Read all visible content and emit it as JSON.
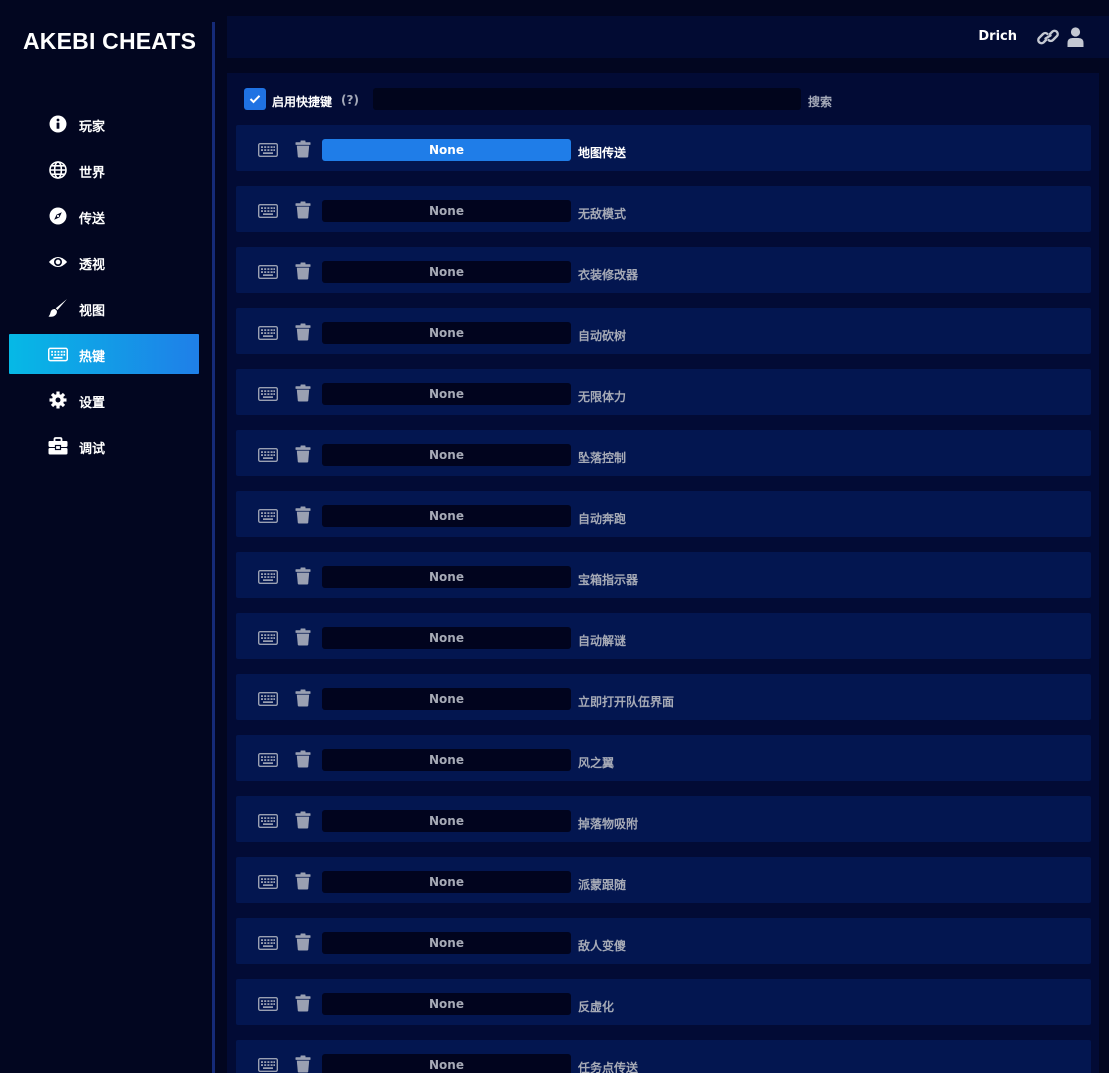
{
  "app": {
    "title": "AKEBI CHEATS"
  },
  "sidebar": {
    "items": [
      {
        "label": "玩家",
        "icon": "info-circle-icon",
        "active": false
      },
      {
        "label": "世界",
        "icon": "globe-icon",
        "active": false
      },
      {
        "label": "传送",
        "icon": "compass-icon",
        "active": false
      },
      {
        "label": "透视",
        "icon": "eye-icon",
        "active": false
      },
      {
        "label": "视图",
        "icon": "paintbrush-icon",
        "active": false
      },
      {
        "label": "热键",
        "icon": "keyboard-icon",
        "active": true
      },
      {
        "label": "设置",
        "icon": "gear-icon",
        "active": false
      },
      {
        "label": "调试",
        "icon": "toolbox-icon",
        "active": false
      }
    ]
  },
  "header": {
    "username": "Drich",
    "icons": [
      "link-icon",
      "user-icon"
    ]
  },
  "toolbar": {
    "enable_label": "启用快捷键",
    "enable_checked": true,
    "help": "(?)",
    "search_value": "",
    "search_label": "搜索"
  },
  "hotkeys": [
    {
      "key": "None",
      "name": "地图传送",
      "active": true
    },
    {
      "key": "None",
      "name": "无敌模式",
      "active": false
    },
    {
      "key": "None",
      "name": "衣装修改器",
      "active": false
    },
    {
      "key": "None",
      "name": "自动砍树",
      "active": false
    },
    {
      "key": "None",
      "name": "无限体力",
      "active": false
    },
    {
      "key": "None",
      "name": "坠落控制",
      "active": false
    },
    {
      "key": "None",
      "name": "自动奔跑",
      "active": false
    },
    {
      "key": "None",
      "name": "宝箱指示器",
      "active": false
    },
    {
      "key": "None",
      "name": "自动解谜",
      "active": false
    },
    {
      "key": "None",
      "name": "立即打开队伍界面",
      "active": false
    },
    {
      "key": "None",
      "name": "风之翼",
      "active": false
    },
    {
      "key": "None",
      "name": "掉落物吸附",
      "active": false
    },
    {
      "key": "None",
      "name": "派蒙跟随",
      "active": false
    },
    {
      "key": "None",
      "name": "敌人变傻",
      "active": false
    },
    {
      "key": "None",
      "name": "反虚化",
      "active": false
    },
    {
      "key": "None",
      "name": "任务点传送",
      "active": false
    }
  ],
  "colors": {
    "accent": "#1f7de8",
    "sidebar_active_start": "#06b9e6",
    "row_bg": "#031650",
    "background": "#020620"
  }
}
